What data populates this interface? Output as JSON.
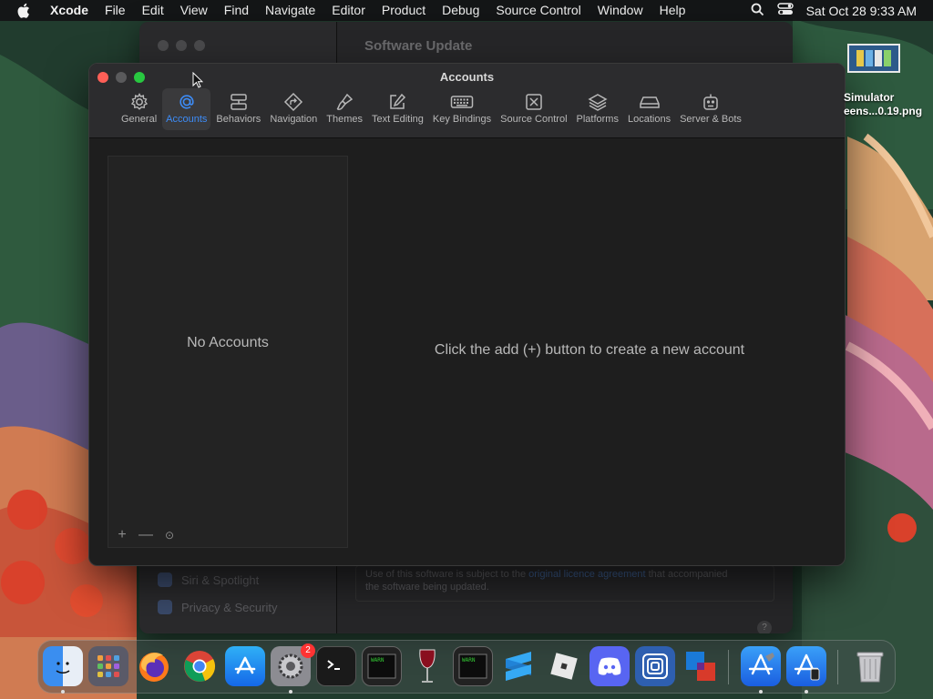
{
  "menubar": {
    "app_name": "Xcode",
    "items": [
      "File",
      "Edit",
      "View",
      "Find",
      "Navigate",
      "Editor",
      "Product",
      "Debug",
      "Source Control",
      "Window",
      "Help"
    ],
    "clock": "Sat Oct 28  9:33 AM"
  },
  "background_window": {
    "title": "Software Update",
    "sidebar_items": [
      "Siri & Spotlight",
      "Privacy & Security"
    ],
    "license_text_1": "Use of this software is subject to the ",
    "license_link": "original licence agreement",
    "license_text_2": " that accompanied",
    "license_text_3": "the software being updated.",
    "help": "?"
  },
  "window": {
    "title": "Accounts",
    "toolbar": [
      {
        "label": "General",
        "icon": "gear-icon"
      },
      {
        "label": "Accounts",
        "icon": "at-icon",
        "active": true
      },
      {
        "label": "Behaviors",
        "icon": "behaviors-icon"
      },
      {
        "label": "Navigation",
        "icon": "navigation-icon"
      },
      {
        "label": "Themes",
        "icon": "brush-icon"
      },
      {
        "label": "Text Editing",
        "icon": "pencil-icon"
      },
      {
        "label": "Key Bindings",
        "icon": "keyboard-icon"
      },
      {
        "label": "Source Control",
        "icon": "source-control-icon"
      },
      {
        "label": "Platforms",
        "icon": "layers-icon"
      },
      {
        "label": "Locations",
        "icon": "drive-icon"
      },
      {
        "label": "Server & Bots",
        "icon": "robot-icon"
      }
    ],
    "no_accounts": "No Accounts",
    "empty_message": "Click the add (+) button to create a new account",
    "controls": {
      "add": "+",
      "remove": "—",
      "more": "⊙"
    }
  },
  "desktop_file": {
    "line1": "Simulator",
    "line2": "eens...0.19.png"
  },
  "dock": {
    "settings_badge": "2",
    "items": [
      "Finder",
      "Launchpad",
      "Firefox",
      "Chrome",
      "App Store",
      "System Settings",
      "Terminal",
      "Console",
      "Wine",
      "Console 2",
      "Sublime",
      "Roblox",
      "Discord",
      "Gradient",
      "Sourcetree",
      "Xcode",
      "Simulator",
      "Trash"
    ]
  },
  "colors": {
    "accent": "#3d8cf7",
    "close": "#ff5f57",
    "zoom": "#28c840"
  }
}
